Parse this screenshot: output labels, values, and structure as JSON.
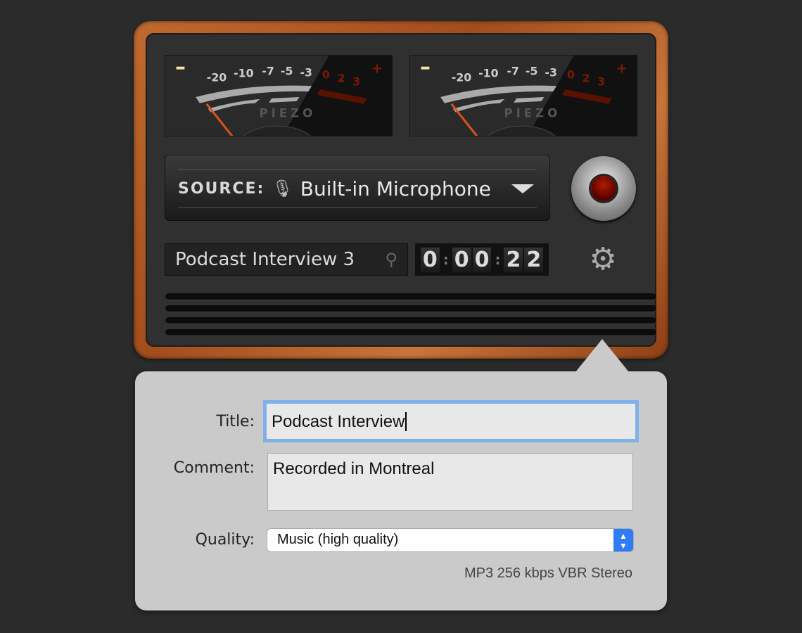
{
  "meters": {
    "brand": "PIEZO",
    "minus": "−",
    "plus": "+",
    "scale": [
      "-20",
      "-10",
      "-7",
      "-5",
      "-3"
    ],
    "red_scale": [
      "0",
      "2",
      "3"
    ]
  },
  "source": {
    "label": "SOURCE:",
    "value": "Built-in Microphone",
    "icon": "microphone-icon"
  },
  "recording": {
    "name": "Podcast Interview 3",
    "timer": [
      "0",
      "0",
      "0",
      "2",
      "2"
    ]
  },
  "popover": {
    "title_label": "Title:",
    "title_value": "Podcast Interview",
    "comment_label": "Comment:",
    "comment_value": "Recorded in Montreal",
    "quality_label": "Quality:",
    "quality_value": "Music (high quality)",
    "format": "MP3 256 kbps VBR Stereo"
  },
  "colors": {
    "wood": "#b05a24",
    "record": "#8a1000",
    "focus": "#7fb0ea",
    "needle": "#e0501e"
  }
}
